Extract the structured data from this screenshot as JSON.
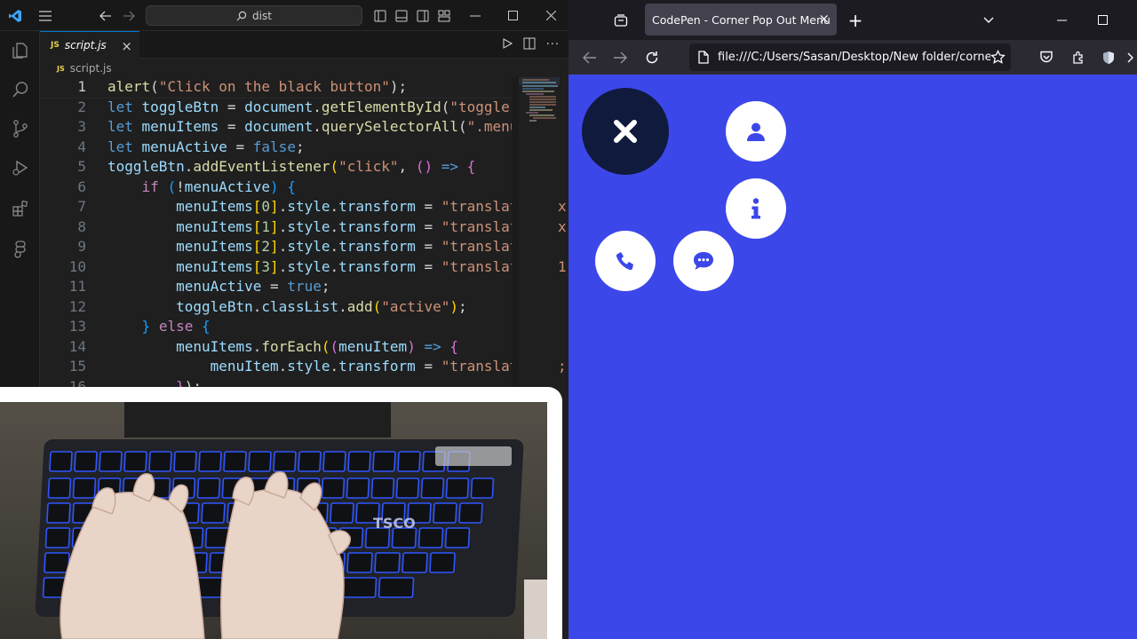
{
  "vscode": {
    "search_text": "dist",
    "tab_label": "script.js",
    "js_badge": "JS",
    "breadcrumb": "script.js",
    "code_lines": [
      {
        "n": "1",
        "html": "<span style=\"color:#dcdcaa\">alert</span><span style=\"color:#d4d4d4\">(</span><span style=\"color:#ce9178\">\"Click on the black button\"</span><span>);</span>"
      },
      {
        "n": "2",
        "html": "<span style=\"color:#569cd6\">let</span> <span style=\"color:#9cdcfe\">toggleBtn</span> = <span style=\"color:#9cdcfe\">document</span>.<span style=\"color:#dcdcaa\">getElementById</span>(<span style=\"color:#ce9178\">\"toggle-b</span>"
      },
      {
        "n": "3",
        "html": "<span style=\"color:#569cd6\">let</span> <span style=\"color:#9cdcfe\">menuItems</span> = <span style=\"color:#9cdcfe\">document</span>.<span style=\"color:#dcdcaa\">querySelectorAll</span>(<span style=\"color:#ce9178\">\".menu</span>"
      },
      {
        "n": "4",
        "html": "<span style=\"color:#569cd6\">let</span> <span style=\"color:#9cdcfe\">menuActive</span> = <span style=\"color:#569cd6\">false</span>;"
      },
      {
        "n": "5",
        "html": "<span style=\"color:#9cdcfe\">toggleBtn</span>.<span style=\"color:#dcdcaa\">addEventListener</span><span style=\"color:#ffd700\">(</span><span style=\"color:#ce9178\">\"click\"</span>, <span style=\"color:#da70d6\">()</span> <span style=\"color:#569cd6\">=&gt;</span> <span style=\"color:#da70d6\">{</span>"
      },
      {
        "n": "6",
        "html": "    <span style=\"color:#c586c0\">if</span> <span style=\"color:#179fff\">(</span>!<span style=\"color:#9cdcfe\">menuActive</span><span style=\"color:#179fff\">)</span> <span style=\"color:#179fff\">{</span>"
      },
      {
        "n": "7",
        "html": "        <span style=\"color:#9cdcfe\">menuItems</span><span style=\"color:#ffd700\">[</span><span style=\"color:#b5cea8\">0</span><span style=\"color:#ffd700\">]</span>.<span style=\"color:#9cdcfe\">style</span>.<span style=\"color:#9cdcfe\">transform</span> = <span style=\"color:#ce9178\">\"translate</span>"
      },
      {
        "n": "8",
        "html": "        <span style=\"color:#9cdcfe\">menuItems</span><span style=\"color:#ffd700\">[</span><span style=\"color:#b5cea8\">1</span><span style=\"color:#ffd700\">]</span>.<span style=\"color:#9cdcfe\">style</span>.<span style=\"color:#9cdcfe\">transform</span> = <span style=\"color:#ce9178\">\"translate</span>"
      },
      {
        "n": "9",
        "html": "        <span style=\"color:#9cdcfe\">menuItems</span><span style=\"color:#ffd700\">[</span><span style=\"color:#b5cea8\">2</span><span style=\"color:#ffd700\">]</span>.<span style=\"color:#9cdcfe\">style</span>.<span style=\"color:#9cdcfe\">transform</span> = <span style=\"color:#ce9178\">\"translate</span>"
      },
      {
        "n": "10",
        "html": "        <span style=\"color:#9cdcfe\">menuItems</span><span style=\"color:#ffd700\">[</span><span style=\"color:#b5cea8\">3</span><span style=\"color:#ffd700\">]</span>.<span style=\"color:#9cdcfe\">style</span>.<span style=\"color:#9cdcfe\">transform</span> = <span style=\"color:#ce9178\">\"translate</span>"
      },
      {
        "n": "11",
        "html": "        <span style=\"color:#9cdcfe\">menuActive</span> = <span style=\"color:#569cd6\">true</span>;"
      },
      {
        "n": "12",
        "html": "        <span style=\"color:#9cdcfe\">toggleBtn</span>.<span style=\"color:#9cdcfe\">classList</span>.<span style=\"color:#dcdcaa\">add</span><span style=\"color:#ffd700\">(</span><span style=\"color:#ce9178\">\"active\"</span><span style=\"color:#ffd700\">)</span>;"
      },
      {
        "n": "13",
        "html": "    <span style=\"color:#179fff\">}</span> <span style=\"color:#c586c0\">else</span> <span style=\"color:#179fff\">{</span>"
      },
      {
        "n": "14",
        "html": "        <span style=\"color:#9cdcfe\">menuItems</span>.<span style=\"color:#dcdcaa\">forEach</span><span style=\"color:#ffd700\">(</span><span style=\"color:#da70d6\">(</span><span style=\"color:#9cdcfe\">menuItem</span><span style=\"color:#da70d6\">)</span> <span style=\"color:#569cd6\">=&gt;</span> <span style=\"color:#da70d6\">{</span>"
      },
      {
        "n": "15",
        "html": "            <span style=\"color:#9cdcfe\">menuItem</span>.<span style=\"color:#9cdcfe\">style</span>.<span style=\"color:#9cdcfe\">transform</span> = <span style=\"color:#ce9178\">\"translate</span>"
      },
      {
        "n": "16",
        "html": "        <span style=\"color:#da70d6\">}</span>);"
      }
    ],
    "overflow_fragments": [
      "",
      "",
      "",
      "",
      "",
      "",
      "x,",
      "x,",
      "",
      "1",
      "",
      "",
      "",
      "",
      ";",
      ""
    ]
  },
  "firefox": {
    "tab_title": "CodePen - Corner Pop Out Menu",
    "url": "file:///C:/Users/Sasan/Desktop/New folder/corner-",
    "page_bg": "#3c47e9",
    "menu": {
      "toggle_icon": "close-icon",
      "items": [
        "user-icon",
        "info-icon",
        "chat-icon",
        "phone-icon"
      ]
    }
  }
}
